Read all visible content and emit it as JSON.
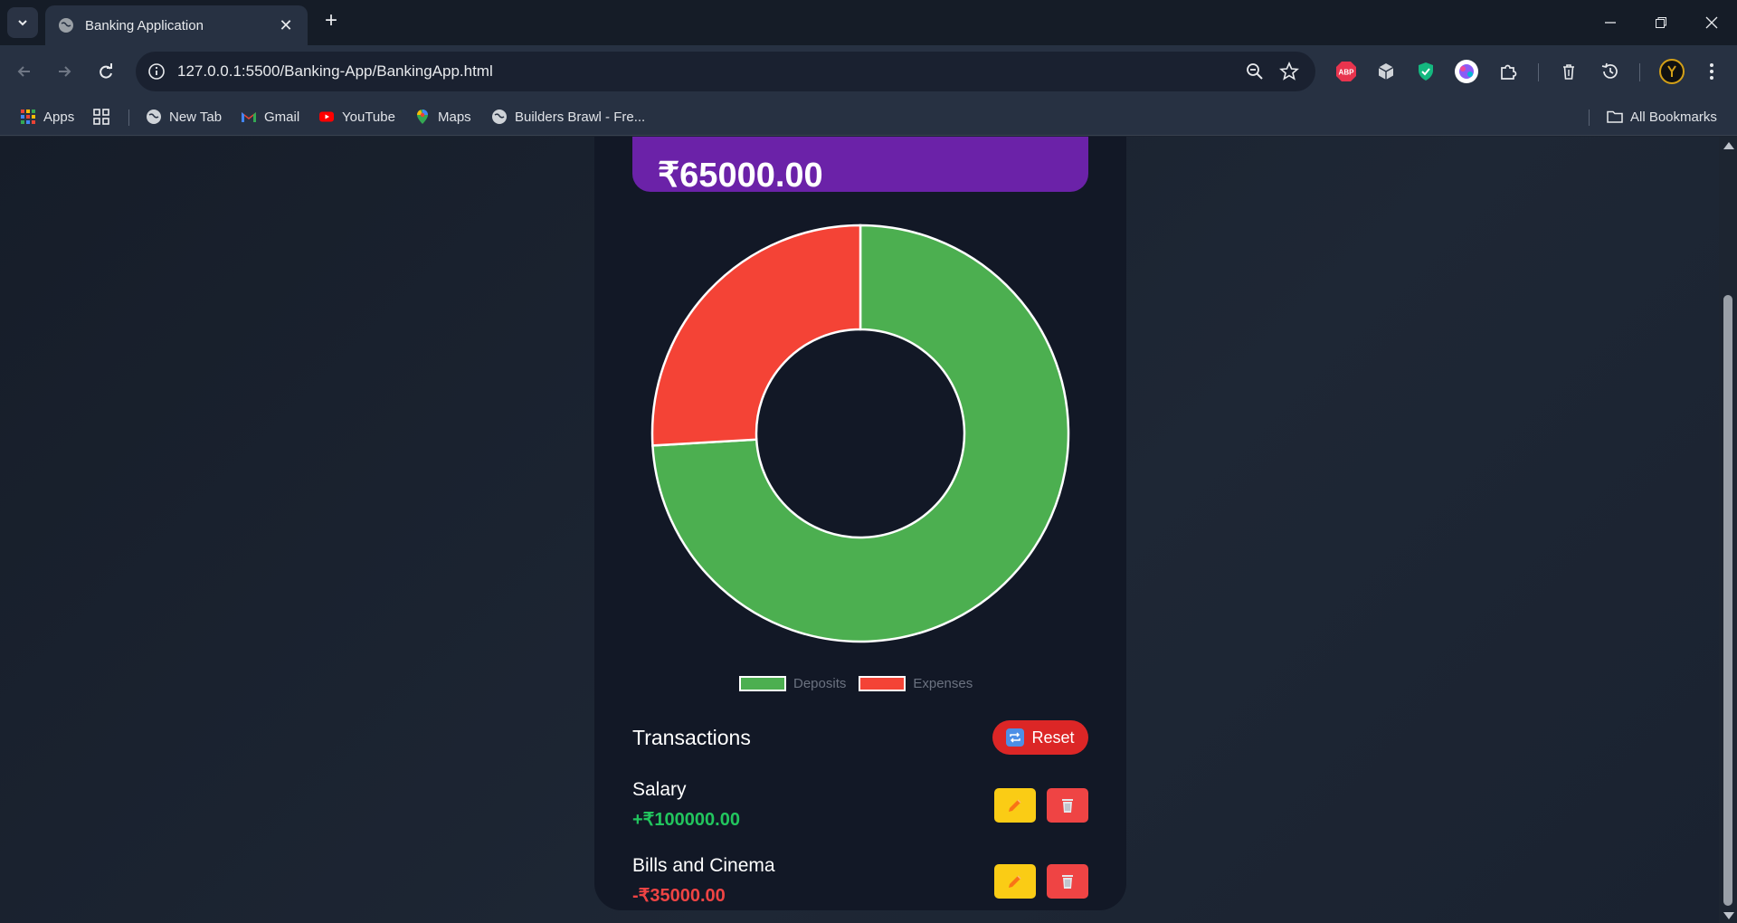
{
  "browser": {
    "tab_title": "Banking Application",
    "url": "127.0.0.1:5500/Banking-App/BankingApp.html",
    "new_tab_symbol": "+",
    "close_symbol": "✕",
    "bookmarks": [
      {
        "label": "Apps",
        "icon": "apps-grid-icon"
      },
      {
        "label": "New Tab",
        "icon": "globe-icon"
      },
      {
        "label": "Gmail",
        "icon": "gmail-icon"
      },
      {
        "label": "YouTube",
        "icon": "youtube-icon"
      },
      {
        "label": "Maps",
        "icon": "maps-pin-icon"
      },
      {
        "label": "Builders Brawl - Fre...",
        "icon": "globe-icon"
      }
    ],
    "all_bookmarks": "All Bookmarks",
    "extension_abp_label": "ABP"
  },
  "app": {
    "balance": "₹65000.00",
    "transactions_title": "Transactions",
    "reset_label": "Reset",
    "transactions": [
      {
        "name": "Salary",
        "amount": "+₹100000.00",
        "color": "#22c55e"
      },
      {
        "name": "Bills and Cinema",
        "amount": "-₹35000.00",
        "color": "#ef4444"
      }
    ]
  },
  "chart_data": {
    "type": "pie",
    "categories": [
      "Deposits",
      "Expenses"
    ],
    "values": [
      100000,
      35000
    ],
    "colors": [
      "#4caf50",
      "#f44336"
    ],
    "donut": true,
    "legend": "bottom"
  }
}
